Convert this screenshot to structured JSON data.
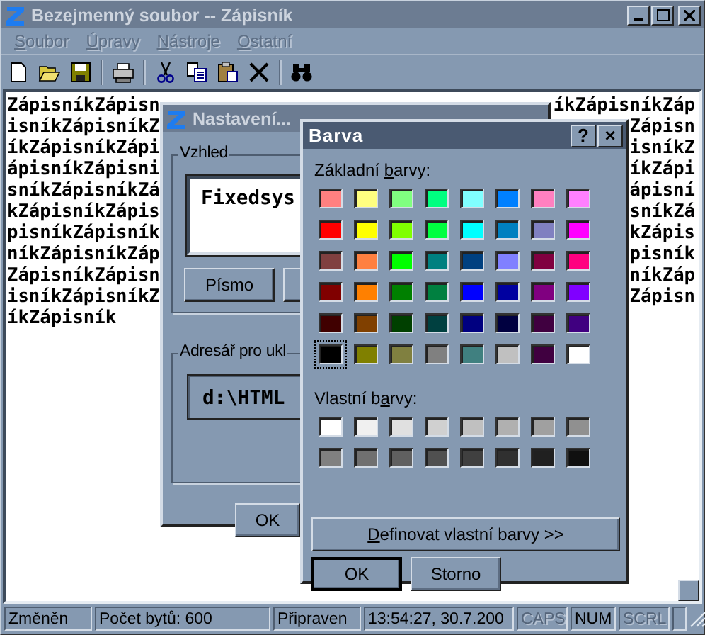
{
  "window": {
    "title": "Bezejmenný soubor -- Zápisník",
    "active": false,
    "controls": [
      {
        "kind": "minimize"
      },
      {
        "kind": "maximize"
      },
      {
        "kind": "close"
      }
    ]
  },
  "menu": [
    {
      "key": "S",
      "post": "oubor"
    },
    {
      "key": "Ú",
      "post": "pravy"
    },
    {
      "key": "N",
      "post": "ástroje"
    },
    {
      "key": "O",
      "post": "statní"
    }
  ],
  "toolbar": [
    {
      "kind": "new"
    },
    {
      "kind": "open"
    },
    {
      "kind": "save"
    },
    {
      "kind": "sep"
    },
    {
      "kind": "print"
    },
    {
      "kind": "sep"
    },
    {
      "kind": "cut"
    },
    {
      "kind": "copy"
    },
    {
      "kind": "paste"
    },
    {
      "kind": "delete"
    },
    {
      "kind": "sep"
    },
    {
      "kind": "find"
    }
  ],
  "editor": {
    "lines": [
      {
        "left": "ZápisníkZápisn",
        "right": "íkZápisníkZáp"
      },
      {
        "left": "isníkZápisníkZ",
        "right": "Zápisn"
      },
      {
        "left": "íkZápisníkZápi",
        "right": "isníkZ"
      },
      {
        "left": "ápisníkZápisni",
        "right": "íkZápi"
      },
      {
        "left": "sníkZápisníkZá",
        "right": "ápisní"
      },
      {
        "left": "kZápisníkZápis",
        "right": "sníkZá"
      },
      {
        "left": "pisníkZápisník",
        "right": "kZápis"
      },
      {
        "left": "níkZápisníkZáp",
        "right": "pisník"
      },
      {
        "left": "ZápisníkZápisn",
        "right": "níkZáp"
      },
      {
        "left": "isníkZápisníkZ",
        "right": "Zápisn"
      },
      {
        "left": "íkZápisník"
      }
    ]
  },
  "settings_dialog": {
    "title": "Nastavení...",
    "active": false,
    "appearance_group": {
      "label": "Vzhled",
      "font_preview": "Fixedsys",
      "font_button": "Písmo"
    },
    "folder_group": {
      "label": "Adresář pro ukl",
      "path": "d:\\HTML"
    },
    "ok_button": "OK"
  },
  "color_dialog": {
    "title": "Barva",
    "active": true,
    "help_button": "?",
    "close_button": "×",
    "basic_label": {
      "pre": "Základní ",
      "key": "b",
      "post": "arvy:"
    },
    "basic_colors": [
      {
        "color": "#ff8080",
        "selected": false
      },
      {
        "color": "#ffff80",
        "selected": false
      },
      {
        "color": "#80ff80",
        "selected": false
      },
      {
        "color": "#00ff80",
        "selected": false
      },
      {
        "color": "#80ffff",
        "selected": false
      },
      {
        "color": "#0080ff",
        "selected": false
      },
      {
        "color": "#ff80c0",
        "selected": false
      },
      {
        "color": "#ff80ff",
        "selected": false
      },
      {
        "color": "#ff0000",
        "selected": false
      },
      {
        "color": "#ffff00",
        "selected": false
      },
      {
        "color": "#80ff00",
        "selected": false
      },
      {
        "color": "#00ff40",
        "selected": false
      },
      {
        "color": "#00ffff",
        "selected": false
      },
      {
        "color": "#0080c0",
        "selected": false
      },
      {
        "color": "#8080c0",
        "selected": false
      },
      {
        "color": "#ff00ff",
        "selected": false
      },
      {
        "color": "#804040",
        "selected": false
      },
      {
        "color": "#ff8040",
        "selected": false
      },
      {
        "color": "#00ff00",
        "selected": false
      },
      {
        "color": "#008080",
        "selected": false
      },
      {
        "color": "#004080",
        "selected": false
      },
      {
        "color": "#8080ff",
        "selected": false
      },
      {
        "color": "#800040",
        "selected": false
      },
      {
        "color": "#ff0080",
        "selected": false
      },
      {
        "color": "#800000",
        "selected": false
      },
      {
        "color": "#ff8000",
        "selected": false
      },
      {
        "color": "#008000",
        "selected": false
      },
      {
        "color": "#008040",
        "selected": false
      },
      {
        "color": "#0000ff",
        "selected": false
      },
      {
        "color": "#0000a0",
        "selected": false
      },
      {
        "color": "#800080",
        "selected": false
      },
      {
        "color": "#8000ff",
        "selected": false
      },
      {
        "color": "#400000",
        "selected": false
      },
      {
        "color": "#804000",
        "selected": false
      },
      {
        "color": "#004000",
        "selected": false
      },
      {
        "color": "#004040",
        "selected": false
      },
      {
        "color": "#000080",
        "selected": false
      },
      {
        "color": "#000040",
        "selected": false
      },
      {
        "color": "#400040",
        "selected": false
      },
      {
        "color": "#400080",
        "selected": false
      },
      {
        "color": "#000000",
        "selected": true
      },
      {
        "color": "#808000",
        "selected": false
      },
      {
        "color": "#808040",
        "selected": false
      },
      {
        "color": "#808080",
        "selected": false
      },
      {
        "color": "#408080",
        "selected": false
      },
      {
        "color": "#c0c0c0",
        "selected": false
      },
      {
        "color": "#400040",
        "selected": false
      },
      {
        "color": "#ffffff",
        "selected": false
      }
    ],
    "custom_label": {
      "pre": "Vlastní b",
      "key": "a",
      "post": "rvy:"
    },
    "custom_colors": [
      {
        "color": "#ffffff",
        "selected": false
      },
      {
        "color": "#f0f0f0",
        "selected": false
      },
      {
        "color": "#e0e0e0",
        "selected": false
      },
      {
        "color": "#d0d0d0",
        "selected": false
      },
      {
        "color": "#c0c0c0",
        "selected": false
      },
      {
        "color": "#b0b0b0",
        "selected": false
      },
      {
        "color": "#a0a0a0",
        "selected": false
      },
      {
        "color": "#909090",
        "selected": false
      },
      {
        "color": "#808080",
        "selected": false
      },
      {
        "color": "#707070",
        "selected": false
      },
      {
        "color": "#606060",
        "selected": false
      },
      {
        "color": "#505050",
        "selected": false
      },
      {
        "color": "#404040",
        "selected": false
      },
      {
        "color": "#303030",
        "selected": false
      },
      {
        "color": "#202020",
        "selected": false
      },
      {
        "color": "#101010",
        "selected": false
      }
    ],
    "define_button": {
      "key": "D",
      "post": "efinovat vlastní barvy >>"
    },
    "ok_button": "OK",
    "cancel_button": "Storno"
  },
  "status_bar": [
    {
      "text": "Změněn",
      "disabled": false
    },
    {
      "text": "Počet bytů: 600",
      "disabled": false
    },
    {
      "text": "Připraven",
      "disabled": false
    },
    {
      "text": "13:54:27, 30.7.200",
      "disabled": false
    },
    {
      "text": "CAPS",
      "disabled": true
    },
    {
      "text": "NUM",
      "disabled": false
    },
    {
      "text": "SCRL",
      "disabled": true
    }
  ]
}
